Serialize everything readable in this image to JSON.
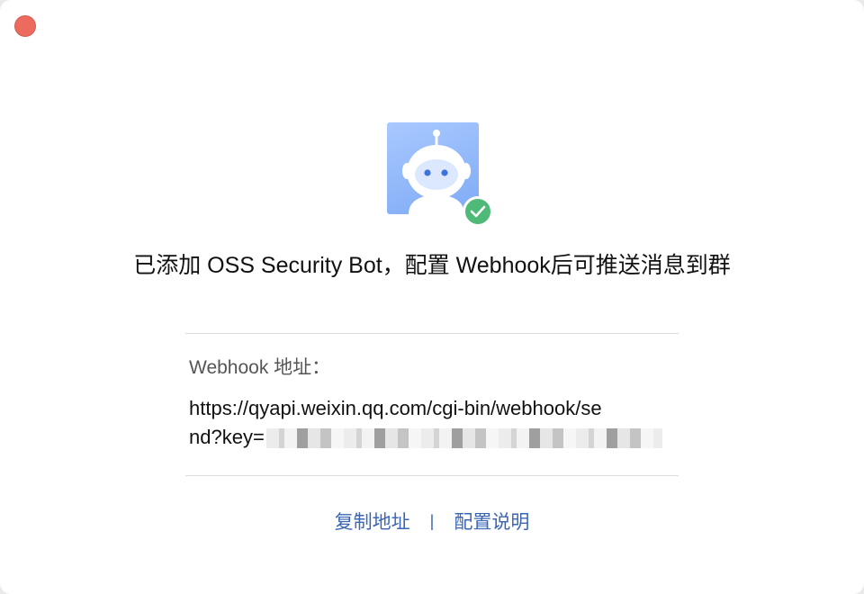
{
  "window": {
    "close_button": "close"
  },
  "dialog": {
    "title": "已添加 OSS Security Bot，配置 Webhook后可推送消息到群",
    "webhook_label": "Webhook 地址：",
    "webhook_url_line1": "https://qyapi.weixin.qq.com/cgi-bin/webhook/se",
    "webhook_url_line2": "nd?key=",
    "copy_link_label": "复制地址",
    "separator": "|",
    "config_help_label": "配置说明"
  },
  "colors": {
    "accent_link": "#3a66b4",
    "success_badge": "#4fb977",
    "close_dot": "#ed6a5e",
    "avatar_bg": "#8fb5f8"
  },
  "icons": {
    "avatar": "robot-avatar-icon",
    "badge": "check-icon"
  }
}
